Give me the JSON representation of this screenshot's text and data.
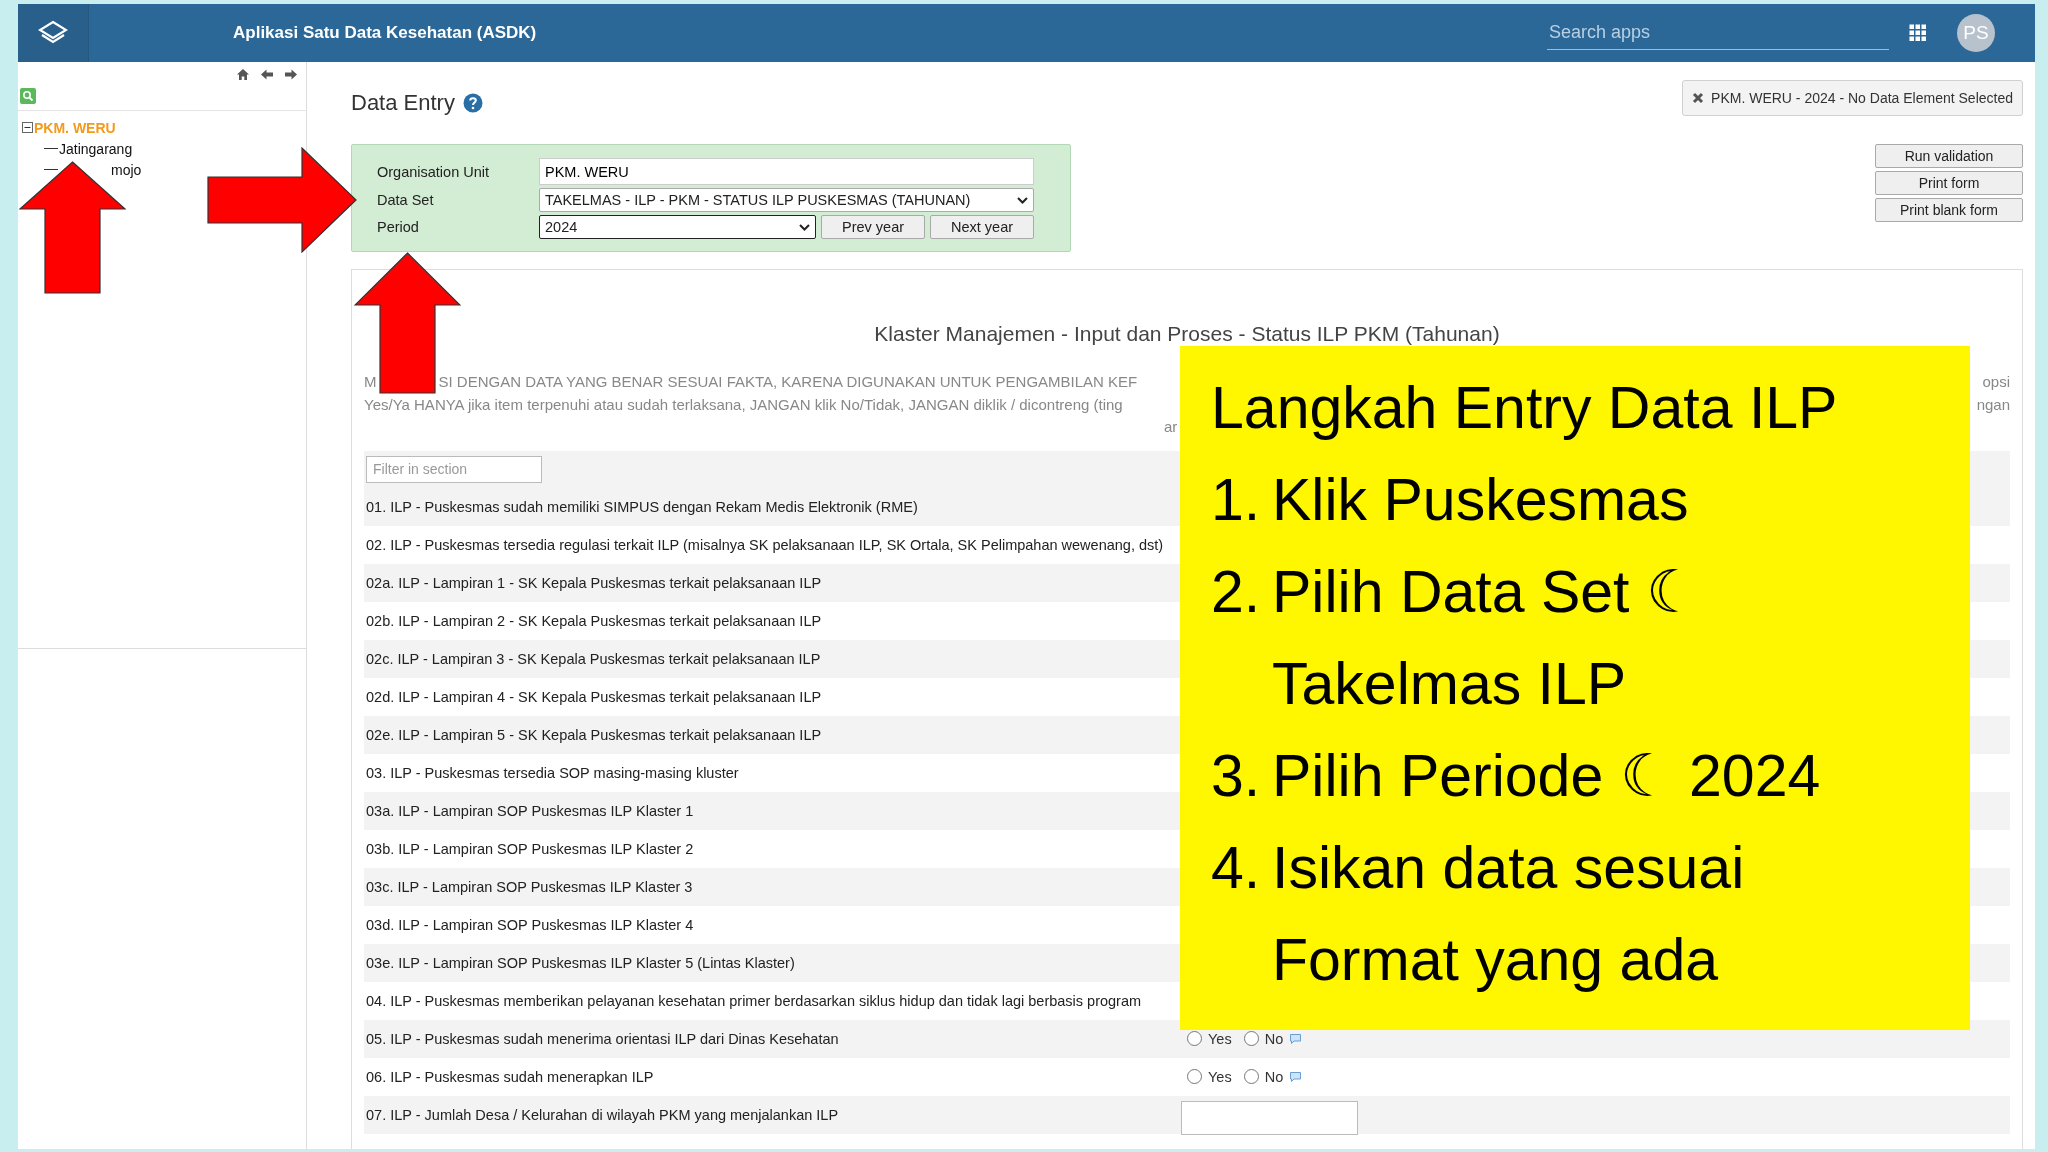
{
  "app_bar": {
    "title": "Aplikasi Satu Data Kesehatan (ASDK)",
    "search": {
      "placeholder": "Search apps"
    },
    "avatar": "PS"
  },
  "sidebar": {
    "tree": [
      {
        "label": "PKM. WERU",
        "expanded": true,
        "selected": true,
        "children": [
          {
            "label": "Jatingarang",
            "selected": false
          },
          {
            "label": "mojo",
            "selected": false
          }
        ]
      }
    ]
  },
  "page_title": "Data Entry",
  "selection_tag": "PKM. WERU - 2024 - No Data Element Selected",
  "form": {
    "fields": [
      {
        "label": "Organisation Unit",
        "kind": "text",
        "value": "PKM. WERU"
      },
      {
        "label": "Data Set",
        "kind": "select",
        "value": "TAKELMAS - ILP - PKM - STATUS ILP PUSKESMAS (TAHUNAN)"
      },
      {
        "label": "Period",
        "kind": "period",
        "value": "2024",
        "buttons": [
          "Prev year",
          "Next year"
        ]
      }
    ]
  },
  "actions": [
    "Run validation",
    "Print form",
    "Print blank form"
  ],
  "section": {
    "title": "Klaster Manajemen - Input dan Proses - Status ILP PKM (Tahunan)",
    "instructions": [
      {
        "left": [
          "M",
          "SI DENGAN DATA YANG BENAR SESUAI FAKTA, KARENA DIGUNAKAN UNTUK PENGAMBILAN KEF"
        ],
        "right": "opsi"
      },
      {
        "left": [
          "Yes/Ya HANYA jika item terpenuhi atau sudah terlaksana, JANGAN klik No/Tidak, JANGAN diklik / dicontreng (ting"
        ],
        "right": "ngan"
      },
      {
        "left": [
          "ar"
        ]
      }
    ],
    "filter": {
      "placeholder": "Filter in section"
    },
    "rows": [
      {
        "label": "01. ILP - Puskesmas sudah memiliki SIMPUS dengan Rekam Medis Elektronik (RME)"
      },
      {
        "label": "02. ILP - Puskesmas tersedia regulasi terkait ILP (misalnya SK pelaksanaan ILP, SK Ortala, SK Pelimpahan wewenang, dst)"
      },
      {
        "label": "02a. ILP - Lampiran 1 - SK Kepala Puskesmas terkait pelaksanaan ILP"
      },
      {
        "label": "02b. ILP - Lampiran 2 - SK Kepala Puskesmas terkait pelaksanaan ILP"
      },
      {
        "label": "02c. ILP - Lampiran 3 - SK Kepala Puskesmas terkait pelaksanaan ILP"
      },
      {
        "label": "02d. ILP - Lampiran 4 - SK Kepala Puskesmas terkait pelaksanaan ILP"
      },
      {
        "label": "02e. ILP - Lampiran 5 - SK Kepala Puskesmas terkait pelaksanaan ILP"
      },
      {
        "label": "03. ILP - Puskesmas tersedia SOP masing-masing kluster"
      },
      {
        "label": "03a. ILP - Lampiran SOP Puskesmas ILP Klaster 1"
      },
      {
        "label": "03b. ILP - Lampiran SOP Puskesmas ILP Klaster 2"
      },
      {
        "label": "03c. ILP - Lampiran SOP Puskesmas ILP Klaster 3"
      },
      {
        "label": "03d. ILP - Lampiran SOP Puskesmas ILP Klaster 4"
      },
      {
        "label": "03e. ILP - Lampiran SOP Puskesmas ILP Klaster 5 (Lintas Klaster)"
      },
      {
        "label": "04. ILP - Puskesmas memberikan pelayanan kesehatan primer berdasarkan siklus hidup dan tidak lagi berbasis program"
      },
      {
        "label": "05. ILP - Puskesmas sudah menerima orientasi ILP dari Dinas Kesehatan",
        "kind": "yesno",
        "options": [
          {
            "label": "Yes",
            "selected": false
          },
          {
            "label": "No",
            "selected": false
          }
        ]
      },
      {
        "label": "06. ILP - Puskesmas sudah menerapkan ILP",
        "kind": "yesno",
        "options": [
          {
            "label": "Yes",
            "selected": false
          },
          {
            "label": "No",
            "selected": false
          }
        ]
      },
      {
        "label": "07. ILP - Jumlah Desa / Kelurahan di wilayah PKM yang menjalankan ILP",
        "kind": "number"
      }
    ]
  },
  "overlay": {
    "title": "Langkah Entry Data ILP",
    "steps": [
      {
        "number": "1.",
        "lines": [
          "Klik Puskesmas"
        ]
      },
      {
        "number": "2.",
        "lines": [
          "Pilih Data Set ☾",
          "Takelmas ILP"
        ]
      },
      {
        "number": "3.",
        "lines": [
          "Pilih Periode ☾ 2024"
        ]
      },
      {
        "number": "4.",
        "lines": [
          "Isikan data sesuai",
          "Format yang ada"
        ]
      }
    ]
  }
}
